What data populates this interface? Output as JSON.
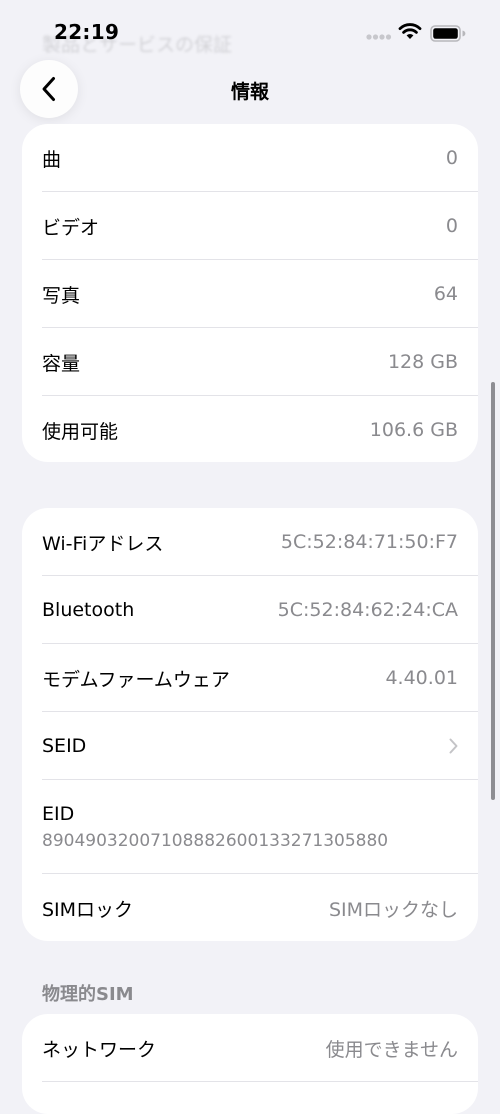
{
  "status_bar": {
    "time": "22:19",
    "faded_title": "製品とサービスの保証"
  },
  "nav": {
    "title": "情報",
    "back_icon": "chevron-left-icon"
  },
  "media_group": {
    "rows": [
      {
        "label": "曲",
        "value": "0"
      },
      {
        "label": "ビデオ",
        "value": "0"
      },
      {
        "label": "写真",
        "value": "64"
      },
      {
        "label": "容量",
        "value": "128 GB"
      },
      {
        "label": "使用可能",
        "value": "106.6 GB"
      }
    ]
  },
  "network_group": {
    "wifi": {
      "label": "Wi-Fiアドレス",
      "value": "5C:52:84:71:50:F7"
    },
    "bluetooth": {
      "label": "Bluetooth",
      "value": "5C:52:84:62:24:CA"
    },
    "modem": {
      "label": "モデムファームウェア",
      "value": "4.40.01"
    },
    "seid": {
      "label": "SEID",
      "icon": "chevron-right-icon"
    },
    "eid": {
      "label": "EID",
      "value": "89049032007108882600133271305880"
    },
    "sim_lock": {
      "label": "SIMロック",
      "value": "SIMロックなし"
    }
  },
  "physical_sim": {
    "header": "物理的SIM",
    "rows": [
      {
        "label": "ネットワーク",
        "value": "使用できません"
      }
    ]
  },
  "colors": {
    "background": "#f2f2f7",
    "card": "#ffffff",
    "secondary_text": "#8a8a8e",
    "separator": "#e3e3e8"
  }
}
